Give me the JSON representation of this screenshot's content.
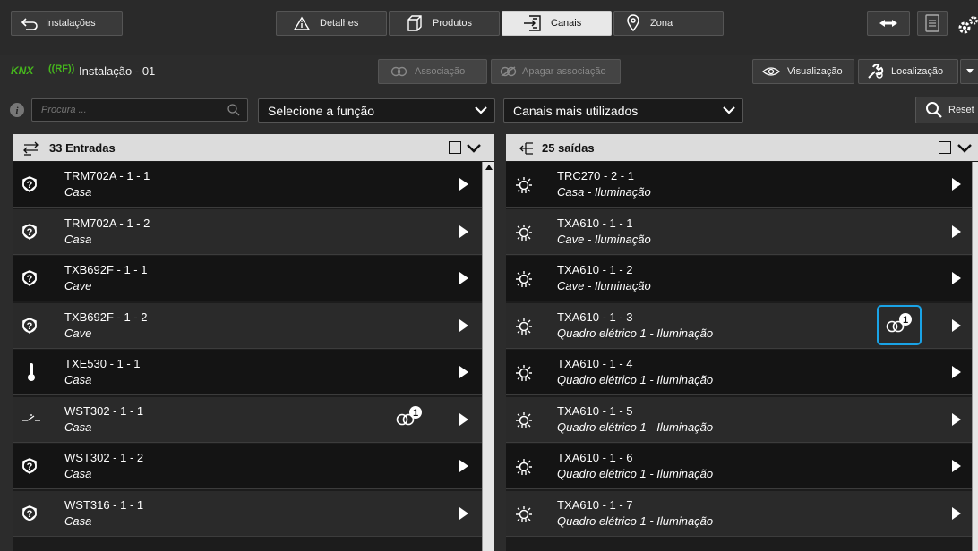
{
  "topbar": {
    "back_label": "Instalações",
    "tabs": [
      {
        "label": "Detalhes",
        "active": false
      },
      {
        "label": "Produtos",
        "active": false
      },
      {
        "label": "Canais",
        "active": true
      },
      {
        "label": "Zona",
        "active": false
      }
    ]
  },
  "installation": {
    "brand": "KNX",
    "rf": "((RF))",
    "name": "Instalação - 01"
  },
  "actions": {
    "associate": "Associação",
    "remove_association": "Apagar associação",
    "visualization": "Visualização",
    "location": "Localização",
    "reset": "Reset"
  },
  "filters": {
    "search_placeholder": "Procura ...",
    "function_select": "Selecione a função",
    "channels_select": "Canais mais utilizados"
  },
  "inputs_panel": {
    "title": "33 Entradas",
    "rows": [
      {
        "name": "TRM702A - 1 - 1",
        "sub": "Casa",
        "icon": "question-icon",
        "badge": null
      },
      {
        "name": "TRM702A - 1 - 2",
        "sub": "Casa",
        "icon": "question-icon",
        "badge": null
      },
      {
        "name": "TXB692F - 1 - 1",
        "sub": "Cave",
        "icon": "question-icon",
        "badge": null
      },
      {
        "name": "TXB692F - 1 - 2",
        "sub": "Cave",
        "icon": "question-icon",
        "badge": null
      },
      {
        "name": "TXE530 - 1 - 1",
        "sub": "Casa",
        "icon": "thermometer-icon",
        "badge": null
      },
      {
        "name": "WST302 - 1 - 1",
        "sub": "Casa",
        "icon": "switch-icon",
        "badge": "1"
      },
      {
        "name": "WST302 - 1 - 2",
        "sub": "Casa",
        "icon": "question-icon",
        "badge": null
      },
      {
        "name": "WST316 - 1 - 1",
        "sub": "Casa",
        "icon": "question-icon",
        "badge": null
      }
    ]
  },
  "outputs_panel": {
    "title": "25 saídas",
    "rows": [
      {
        "name": "TRC270 - 2 - 1",
        "sub": "Casa - Iluminação",
        "badge": null
      },
      {
        "name": "TXA610 - 1 - 1",
        "sub": "Cave - Iluminação",
        "badge": null
      },
      {
        "name": "TXA610 - 1 - 2",
        "sub": "Cave - Iluminação",
        "badge": null
      },
      {
        "name": "TXA610 - 1 - 3",
        "sub": "Quadro elétrico 1 - Iluminação",
        "badge": "1",
        "highlighted": true
      },
      {
        "name": "TXA610 - 1 - 4",
        "sub": "Quadro elétrico 1 - Iluminação",
        "badge": null
      },
      {
        "name": "TXA610 - 1 - 5",
        "sub": "Quadro elétrico 1 - Iluminação",
        "badge": null
      },
      {
        "name": "TXA610 - 1 - 6",
        "sub": "Quadro elétrico 1 - Iluminação",
        "badge": null
      },
      {
        "name": "TXA610 - 1 - 7",
        "sub": "Quadro elétrico 1 - Iluminação",
        "badge": null
      }
    ]
  },
  "colors": {
    "knx_green": "#46b51d",
    "highlight_blue": "#1aa3e6"
  }
}
